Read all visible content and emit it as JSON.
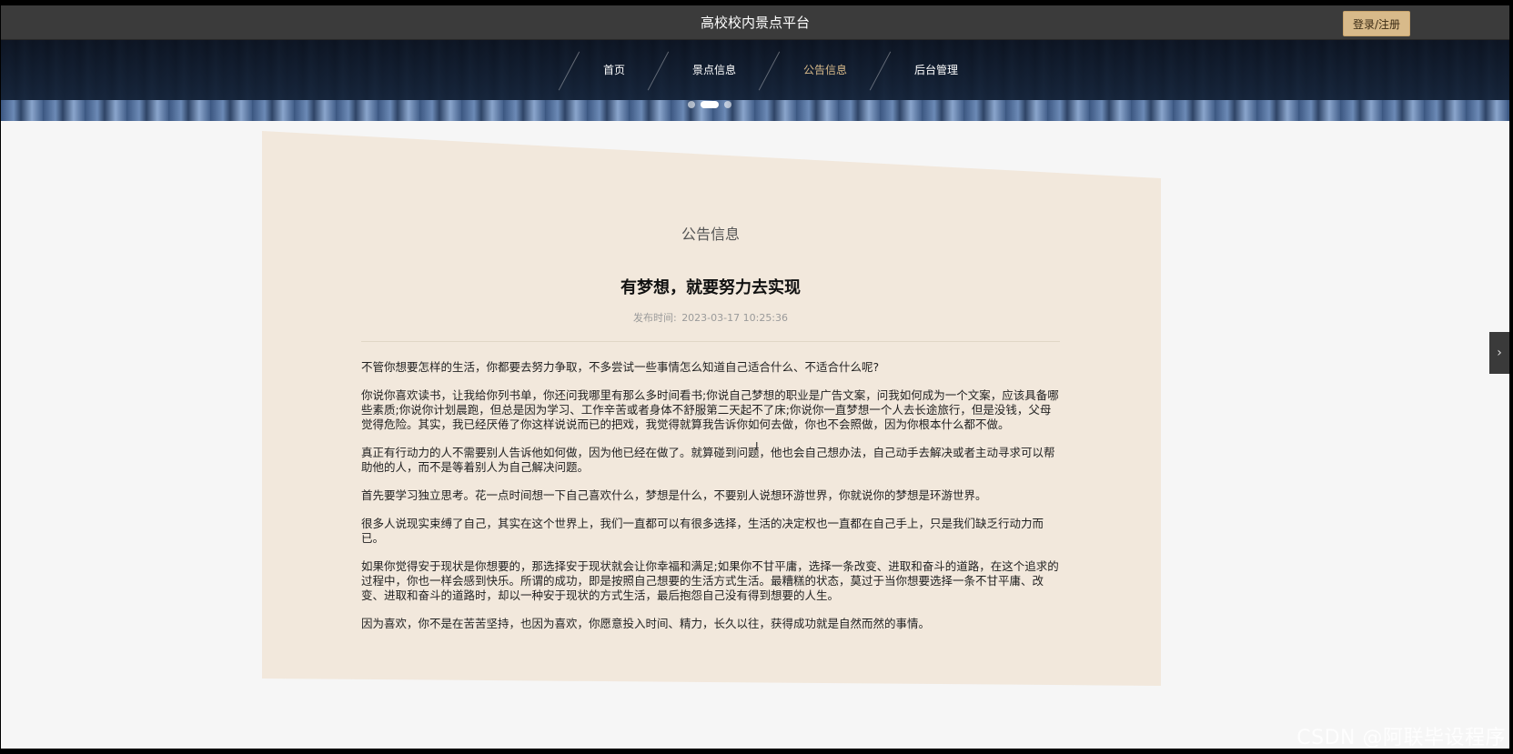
{
  "header": {
    "site_title": "高校校内景点平台",
    "login_label": "登录/注册"
  },
  "nav": {
    "items": [
      {
        "label": "首页",
        "active": false
      },
      {
        "label": "景点信息",
        "active": false
      },
      {
        "label": "公告信息",
        "active": true
      },
      {
        "label": "后台管理",
        "active": false
      }
    ]
  },
  "carousel": {
    "slide_count": 3,
    "active_index": 1
  },
  "content": {
    "section_title": "公告信息",
    "news_title": "有梦想，就要努力去实现",
    "meta_label": "发布时间:",
    "publish_time": "2023-03-17 10:25:36",
    "paragraphs": [
      "不管你想要怎样的生活，你都要去努力争取，不多尝试一些事情怎么知道自己适合什么、不适合什么呢?",
      "你说你喜欢读书，让我给你列书单，你还问我哪里有那么多时间看书;你说自己梦想的职业是广告文案，问我如何成为一个文案，应该具备哪些素质;你说你计划晨跑，但总是因为学习、工作辛苦或者身体不舒服第二天起不了床;你说你一直梦想一个人去长途旅行，但是没钱，父母觉得危险。其实，我已经厌倦了你这样说说而已的把戏，我觉得就算我告诉你如何去做，你也不会照做，因为你根本什么都不做。",
      "真正有行动力的人不需要别人告诉他如何做，因为他已经在做了。就算碰到问题，他也会自己想办法，自己动手去解决或者主动寻求可以帮助他的人，而不是等着别人为自己解决问题。",
      "首先要学习独立思考。花一点时间想一下自己喜欢什么，梦想是什么，不要别人说想环游世界，你就说你的梦想是环游世界。",
      "很多人说现实束缚了自己，其实在这个世界上，我们一直都可以有很多选择，生活的决定权也一直都在自己手上，只是我们缺乏行动力而已。",
      "如果你觉得安于现状是你想要的，那选择安于现状就会让你幸福和满足;如果你不甘平庸，选择一条改变、进取和奋斗的道路，在这个追求的过程中，你也一样会感到快乐。所谓的成功，即是按照自己想要的生活方式生活。最糟糕的状态，莫过于当你想要选择一条不甘平庸、改变、进取和奋斗的道路时，却以一种安于现状的方式生活，最后抱怨自己没有得到想要的人生。",
      "因为喜欢，你不是在苦苦坚持，也因为喜欢，你愿意投入时间、精力，长久以往，获得成功就是自然而然的事情。"
    ]
  },
  "side": {
    "arrow_glyph": "›"
  },
  "watermark": {
    "text": "CSDN @阿联毕设程序"
  },
  "colors": {
    "topbar": "#3b3b3b",
    "accent": "#d8ba8a",
    "card": "#f2e8dc",
    "page_bg": "#f6f6f6"
  }
}
